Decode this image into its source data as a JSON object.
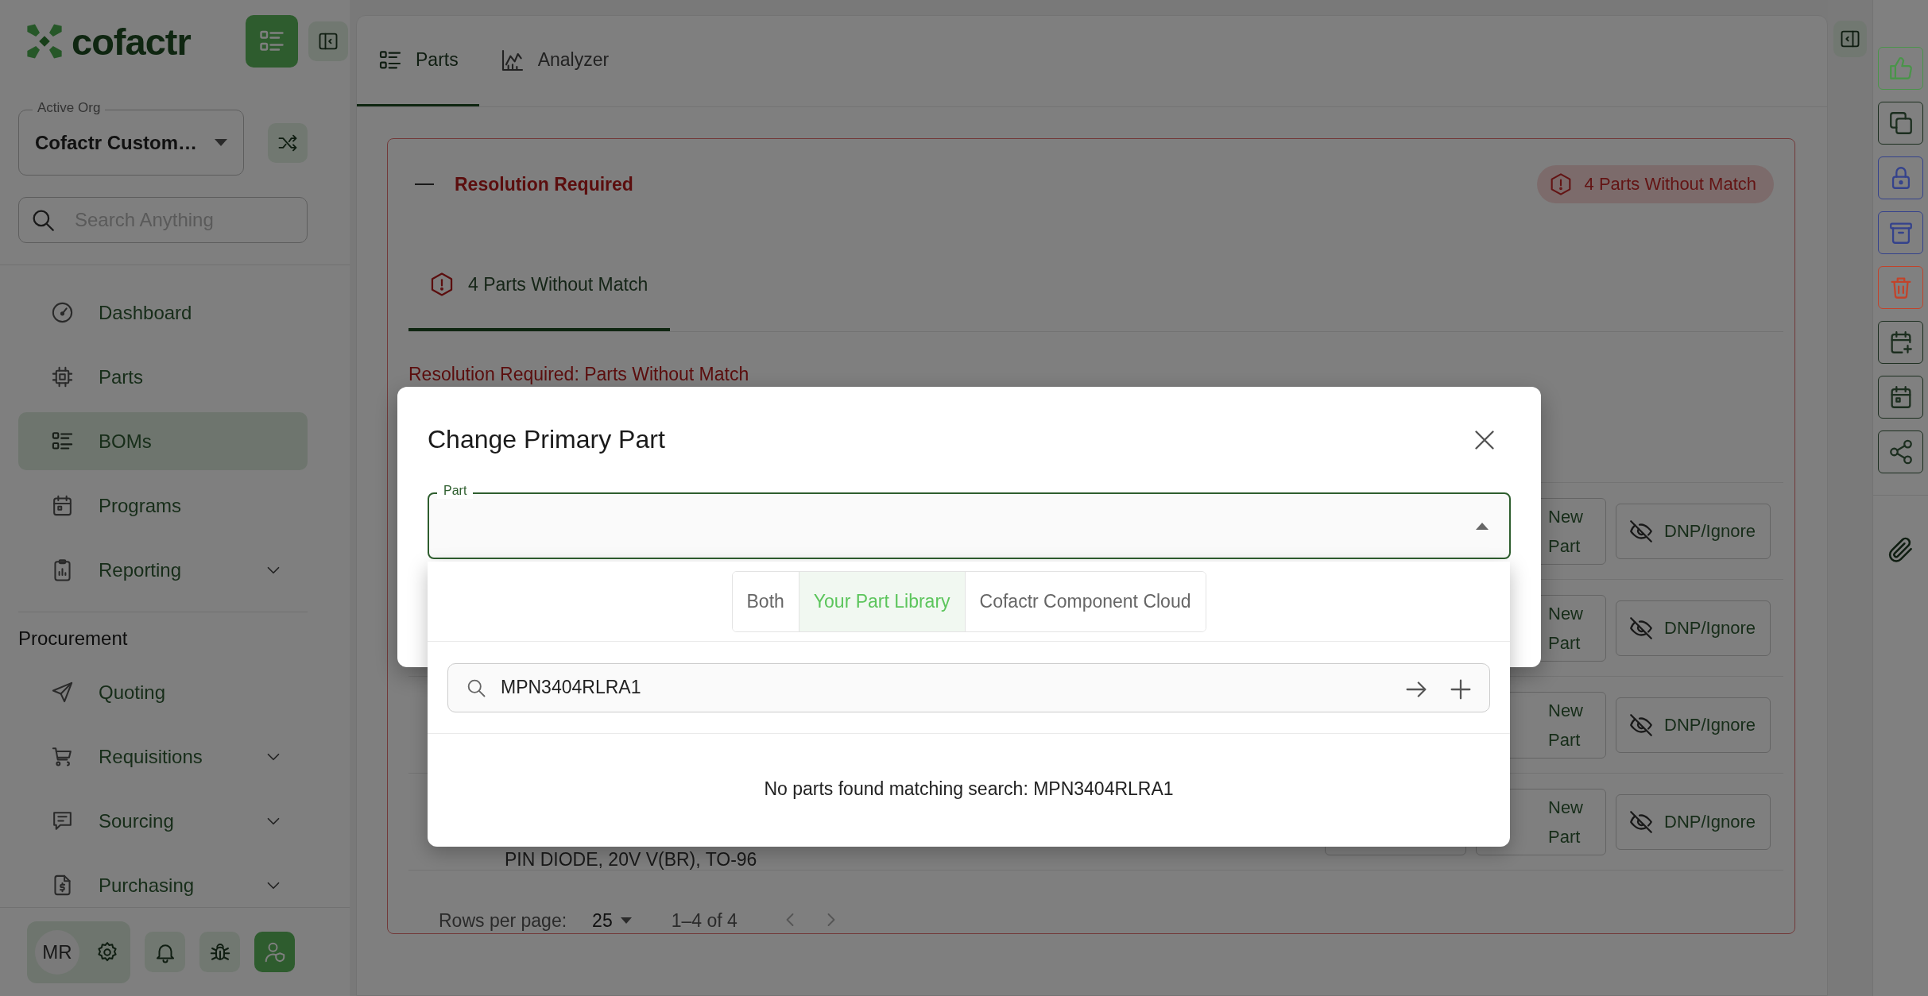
{
  "sidebar": {
    "logo": "cofactr",
    "active_org": {
      "label": "Active Org",
      "value": "Cofactr Custom…"
    },
    "search": {
      "placeholder": "Search Anything"
    },
    "nav": [
      {
        "label": "Dashboard",
        "selected": false,
        "expandable": false
      },
      {
        "label": "Parts",
        "selected": false,
        "expandable": false
      },
      {
        "label": "BOMs",
        "selected": true,
        "expandable": false
      },
      {
        "label": "Programs",
        "selected": false,
        "expandable": false
      },
      {
        "label": "Reporting",
        "selected": false,
        "expandable": true
      }
    ],
    "section": {
      "title": "Procurement",
      "items": [
        {
          "label": "Quoting",
          "selected": false,
          "expandable": false
        },
        {
          "label": "Requisitions",
          "selected": false,
          "expandable": true
        },
        {
          "label": "Sourcing",
          "selected": false,
          "expandable": true
        },
        {
          "label": "Purchasing",
          "selected": false,
          "expandable": true
        }
      ]
    },
    "user": {
      "initials": "MR"
    }
  },
  "tabs": [
    {
      "label": "Parts",
      "selected": true
    },
    {
      "label": "Analyzer",
      "selected": false
    }
  ],
  "resolution": {
    "title": "Resolution Required",
    "badge": "4 Parts Without Match",
    "subtabs": [
      {
        "label": "4 Parts Without Match",
        "selected": true
      }
    ],
    "heading": "Resolution Required: Parts Without Match",
    "rows": [
      {
        "new_part": "New Part",
        "ignore": "DNP/Ignore"
      },
      {
        "new_part": "New Part",
        "ignore": "DNP/Ignore"
      },
      {
        "new_part": "New Part",
        "ignore": "DNP/Ignore"
      },
      {
        "description": "PIN DIODE, 20V V(BR), TO-96",
        "new_part": "New Part",
        "ignore": "DNP/Ignore"
      }
    ],
    "pagination": {
      "label": "Rows per page:",
      "per_page": "25",
      "range": "1–4 of 4"
    }
  },
  "toolbar": [
    {
      "color": "#4a944a"
    },
    {
      "color": "#1c2e1f"
    },
    {
      "color": "#34428c"
    },
    {
      "color": "#34428c"
    },
    {
      "color": "#c2432a"
    },
    {
      "color": "#1c2e1f"
    },
    {
      "color": "#1c2e1f"
    },
    {
      "color": "#1c2e1f"
    }
  ],
  "dialog": {
    "title": "Change Primary Part",
    "field_label": "Part",
    "sources": [
      {
        "label": "Both",
        "selected": false
      },
      {
        "label": "Your Part Library",
        "selected": true
      },
      {
        "label": "Cofactr Component Cloud",
        "selected": false
      }
    ],
    "search_value": "MPN3404RLRA1",
    "empty_message": "No parts found matching search: MPN3404RLRA1"
  }
}
